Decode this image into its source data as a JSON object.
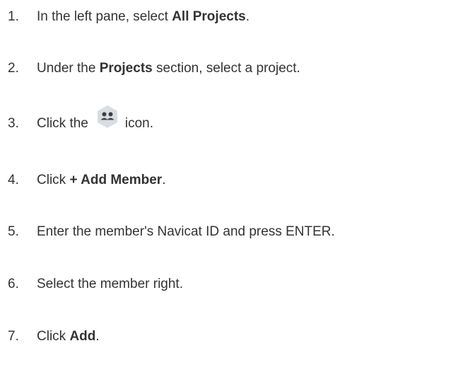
{
  "steps": [
    {
      "num": "1.",
      "before": "In the left pane, select ",
      "bold": "All Projects",
      "after": "."
    },
    {
      "num": "2.",
      "before": "Under the ",
      "bold": "Projects",
      "after": " section, select a project."
    },
    {
      "num": "3.",
      "before": "Click the",
      "icon": "members-icon",
      "after": "icon."
    },
    {
      "num": "4.",
      "before": "Click ",
      "bold": "+ Add Member",
      "after": "."
    },
    {
      "num": "5.",
      "text": "Enter the member's Navicat ID and press ENTER."
    },
    {
      "num": "6.",
      "text": "Select the member right."
    },
    {
      "num": "7.",
      "before": "Click ",
      "bold": "Add",
      "after": "."
    }
  ],
  "colors": {
    "text": "#333333",
    "icon_bg": "#d9dde2",
    "icon_fg": "#3c4043"
  }
}
